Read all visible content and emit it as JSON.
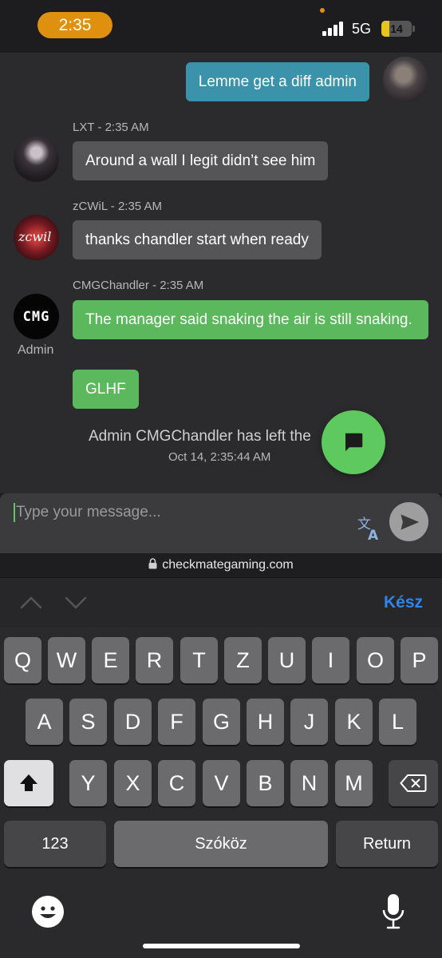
{
  "status_bar": {
    "time": "2:35",
    "network": "5G",
    "battery_level": "14"
  },
  "chat": {
    "outgoing": {
      "text": "Lemme get a diff admin"
    },
    "messages": [
      {
        "author_line": "LXT - 2:35 AM",
        "bubbles": [
          "Around a wall I legit didn’t see him"
        ]
      },
      {
        "author_line": "zCWiL - 2:35 AM",
        "avatar_text": "zcwil",
        "bubbles": [
          "thanks chandler start when ready"
        ]
      },
      {
        "author_line": "CMGChandler - 2:35 AM",
        "avatar_text": "CMG",
        "role": "Admin",
        "bubbles": [
          "The manager said snaking the air is still snaking.",
          "GLHF"
        ]
      }
    ],
    "system": {
      "text": "Admin CMGChandler has left the",
      "time": "Oct 14, 2:35:44 AM"
    }
  },
  "composer": {
    "placeholder": "Type your message..."
  },
  "url_bar": {
    "domain": "checkmategaming.com"
  },
  "keyboard": {
    "done_label": "Kész",
    "row1": [
      "Q",
      "W",
      "E",
      "R",
      "T",
      "Z",
      "U",
      "I",
      "O",
      "P"
    ],
    "row2": [
      "A",
      "S",
      "D",
      "F",
      "G",
      "H",
      "J",
      "K",
      "L"
    ],
    "row3": [
      "Y",
      "X",
      "C",
      "V",
      "B",
      "N",
      "M"
    ],
    "numbers_label": "123",
    "space_label": "Szóköz",
    "return_label": "Return"
  },
  "colors": {
    "accent_orange": "#e0900f",
    "bubble_green": "#5cb85c",
    "bubble_blue": "#3a93ab",
    "done_blue": "#2e86ea"
  }
}
